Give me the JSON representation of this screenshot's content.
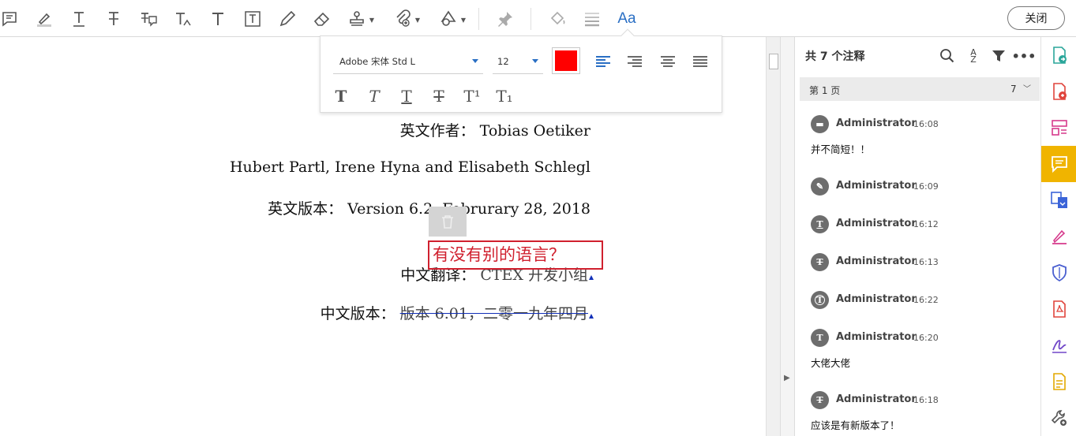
{
  "toolbar": {
    "tools": [
      {
        "name": "sticky-note-tool",
        "icon": "comment-icon"
      },
      {
        "name": "highlight-tool",
        "icon": "highlighter-icon"
      },
      {
        "name": "underline-text-tool",
        "icon": "underline-t-icon"
      },
      {
        "name": "strikethrough-tool",
        "icon": "strikethrough-t-icon"
      },
      {
        "name": "replace-text-tool",
        "icon": "replace-text-icon"
      },
      {
        "name": "insert-text-tool",
        "icon": "insert-text-icon"
      },
      {
        "name": "add-text-comment-tool",
        "icon": "text-t-icon"
      },
      {
        "name": "text-box-tool",
        "icon": "textbox-icon"
      },
      {
        "name": "pencil-tool",
        "icon": "pencil-icon"
      },
      {
        "name": "eraser-tool",
        "icon": "eraser-icon"
      },
      {
        "name": "stamp-tool",
        "icon": "stamp-icon"
      },
      {
        "name": "attach-file-tool",
        "icon": "paperclip-icon"
      },
      {
        "name": "shapes-tool",
        "icon": "shapes-icon"
      },
      {
        "name": "pin-tool",
        "icon": "pin-icon"
      },
      {
        "name": "fill-color-tool",
        "icon": "paint-bucket-icon"
      },
      {
        "name": "line-style-tool",
        "icon": "line-weight-icon"
      },
      {
        "name": "text-format-tool",
        "icon": "aa-icon",
        "label": "Aa"
      }
    ],
    "close_label": "关闭"
  },
  "format_panel": {
    "font": "Adobe 宋体 Std L",
    "size": "12",
    "color": "#ff0000",
    "styles": [
      "T",
      "T",
      "T",
      "T",
      "T¹",
      "T₁"
    ]
  },
  "document": {
    "line1": "英文作者： Tobias Oetiker",
    "line2": "Hubert Partl, Irene Hyna and Elisabeth Schlegl",
    "line3": "英文版本： Version 6.2, Februrary 28, 2018",
    "line4_prefix": "中文翻译：",
    "line4_rest": "CTEX 开发小组",
    "line5_prefix": "中文版本：",
    "line5_struck": "版本 6.01，二零一九年四月",
    "textbox": "有没有别的语言？"
  },
  "comments": {
    "header": "共 7 个注释",
    "page_label": "第 1 页",
    "page_count": "7",
    "items": [
      {
        "author": "Administrator",
        "time": "16:08",
        "text": "并不简短！！",
        "icon": "comment-icon",
        "glyph": "▬"
      },
      {
        "author": "Administrator",
        "time": "16:09",
        "text": "",
        "icon": "highlighter-icon",
        "glyph": "✎"
      },
      {
        "author": "Administrator",
        "time": "16:12",
        "text": "",
        "icon": "underline-t-icon",
        "glyph": "T"
      },
      {
        "author": "Administrator",
        "time": "16:13",
        "text": "",
        "icon": "strikethrough-t-icon",
        "glyph": "T"
      },
      {
        "author": "Administrator",
        "time": "16:22",
        "text": "",
        "icon": "textbox-icon",
        "glyph": "T"
      },
      {
        "author": "Administrator",
        "time": "16:20",
        "text": "大佬大佬",
        "icon": "insert-text-icon",
        "glyph": "T"
      },
      {
        "author": "Administrator",
        "time": "16:18",
        "text": "应该是有新版本了！",
        "icon": "replace-text-icon",
        "glyph": "T"
      }
    ]
  },
  "rail": [
    {
      "name": "export-pdf",
      "icon": "export-pdf-icon",
      "color": "#2aa69a"
    },
    {
      "name": "create-pdf",
      "icon": "create-pdf-icon",
      "color": "#e0443c"
    },
    {
      "name": "organize-pages",
      "icon": "organize-pages-icon",
      "color": "#d63a8c"
    },
    {
      "name": "comment",
      "icon": "comment-panel-icon",
      "color": "#ffffff",
      "active": true
    },
    {
      "name": "combine-files",
      "icon": "combine-files-icon",
      "color": "#3b64d8"
    },
    {
      "name": "fill-sign",
      "icon": "fill-sign-icon",
      "color": "#d63a8c"
    },
    {
      "name": "protect",
      "icon": "shield-icon",
      "color": "#4a5fd0"
    },
    {
      "name": "pdf-file",
      "icon": "pdf-file-icon",
      "color": "#e0443c"
    },
    {
      "name": "send-for-signature",
      "icon": "signature-pen-icon",
      "color": "#7046c8"
    },
    {
      "name": "tools-doc",
      "icon": "document-star-icon",
      "color": "#e3a800"
    },
    {
      "name": "more-tools",
      "icon": "wrench-plus-icon",
      "color": "#555555"
    }
  ]
}
